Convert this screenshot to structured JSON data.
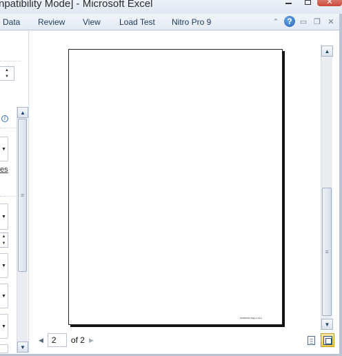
{
  "window": {
    "title": "npatibility Mode] - Microsoft Excel",
    "minimize_icon": "minimize-icon",
    "maximize_icon": "maximize-icon",
    "close_glyph": "✕"
  },
  "ribbon": {
    "tabs": [
      "Data",
      "Review",
      "View",
      "Load Test",
      "Nitro Pro 9"
    ],
    "help_glyph": "?",
    "collapse_glyph": "⌃",
    "restore_glyph": "❐",
    "min_glyph": "▭",
    "close_glyph": "✕"
  },
  "left_panel": {
    "info_glyph": "i",
    "link_text": "es",
    "spinner_up": "▲",
    "spinner_down": "▼",
    "combo_arrow": "▼"
  },
  "preview": {
    "footer_text": "14/08/2014  Page 2 de 2",
    "page_current": "2",
    "page_of": "of 2",
    "prev_arrow": "◀",
    "next_arrow": "▶"
  },
  "scrollbars": {
    "up_arrow": "▲",
    "down_arrow": "▼",
    "grip": "≡"
  },
  "colors": {
    "accent": "#f7c650",
    "titlebar": "#dfe7f2",
    "close": "#c9493a"
  }
}
